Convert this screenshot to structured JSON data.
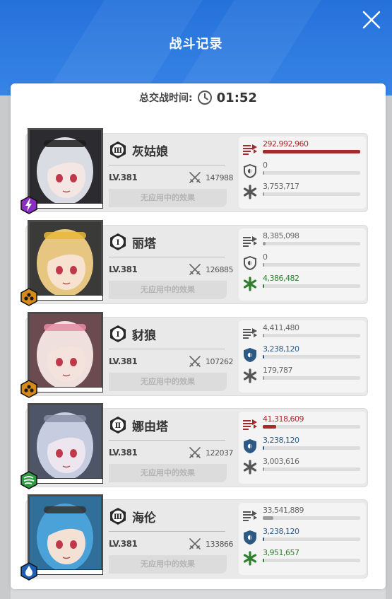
{
  "header": {
    "title": "战斗记录",
    "close_icon": "close-icon"
  },
  "summary": {
    "total_time_label": "总交战时间:",
    "total_time_value": "01:52",
    "clock_icon": "clock-icon"
  },
  "colors": {
    "damage": "#a52a2a",
    "shield": "#2d5a85",
    "heal": "#2f7f2f",
    "neutral": "#666666"
  },
  "characters": [
    {
      "name": "灰姑娘",
      "rank": "Ⅲ",
      "level": "LV.381",
      "combat_power": "147988",
      "effects_text": "无应用中的效果",
      "element": "electric",
      "damage": {
        "value": "292,992,960",
        "ratio": 1.0,
        "highlight": true
      },
      "shield": {
        "value": "0",
        "ratio": 0.0,
        "highlight": false
      },
      "heal": {
        "value": "3,753,717",
        "ratio": 0.0,
        "highlight": false
      }
    },
    {
      "name": "丽塔",
      "rank": "Ⅰ",
      "level": "LV.381",
      "combat_power": "126885",
      "effects_text": "无应用中的效果",
      "element": "iron",
      "damage": {
        "value": "8,385,098",
        "ratio": 0.03,
        "highlight": false
      },
      "shield": {
        "value": "0",
        "ratio": 0.0,
        "highlight": false
      },
      "heal": {
        "value": "4,386,482",
        "ratio": 0.01,
        "highlight": true
      }
    },
    {
      "name": "豺狼",
      "rank": "Ⅰ",
      "level": "LV.381",
      "combat_power": "107262",
      "effects_text": "无应用中的效果",
      "element": "iron",
      "damage": {
        "value": "4,411,480",
        "ratio": 0.015,
        "highlight": false
      },
      "shield": {
        "value": "3,238,120",
        "ratio": 0.01,
        "highlight": true
      },
      "heal": {
        "value": "179,787",
        "ratio": 0.0,
        "highlight": false
      }
    },
    {
      "name": "娜由塔",
      "rank": "Ⅱ",
      "level": "LV.381",
      "combat_power": "122037",
      "effects_text": "无应用中的效果",
      "element": "wind",
      "damage": {
        "value": "41,318,609",
        "ratio": 0.14,
        "highlight": true
      },
      "shield": {
        "value": "3,238,120",
        "ratio": 0.01,
        "highlight": true
      },
      "heal": {
        "value": "3,003,616",
        "ratio": 0.0,
        "highlight": false
      }
    },
    {
      "name": "海伦",
      "rank": "Ⅲ",
      "level": "LV.381",
      "combat_power": "133866",
      "effects_text": "无应用中的效果",
      "element": "water",
      "damage": {
        "value": "33,541,889",
        "ratio": 0.11,
        "highlight": false
      },
      "shield": {
        "value": "3,238,120",
        "ratio": 0.01,
        "highlight": true
      },
      "heal": {
        "value": "3,951,657",
        "ratio": 0.01,
        "highlight": true
      }
    }
  ]
}
